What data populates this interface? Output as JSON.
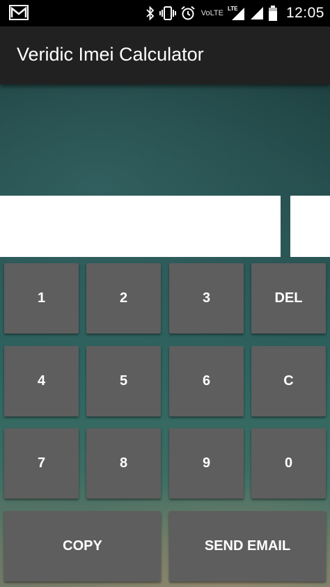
{
  "status_bar": {
    "network_label": "VoLTE",
    "lte_label": "LTE",
    "time": "12:05",
    "icons": [
      "gmail-icon",
      "bluetooth-icon",
      "vibrate-icon",
      "alarm-icon",
      "lte-signal-icon",
      "signal-icon",
      "battery-icon"
    ]
  },
  "app_bar": {
    "title": "Veridic Imei Calculator",
    "background": "#212121"
  },
  "inputs": {
    "imei_value": "",
    "result_value": ""
  },
  "keypad": {
    "key_color": "#5e5e5e",
    "keys": {
      "k1": "1",
      "k2": "2",
      "k3": "3",
      "del": "DEL",
      "k4": "4",
      "k5": "5",
      "k6": "6",
      "clear": "C",
      "k7": "7",
      "k8": "8",
      "k9": "9",
      "k0": "0",
      "copy": "COPY",
      "send_email": "SEND EMAIL"
    }
  }
}
